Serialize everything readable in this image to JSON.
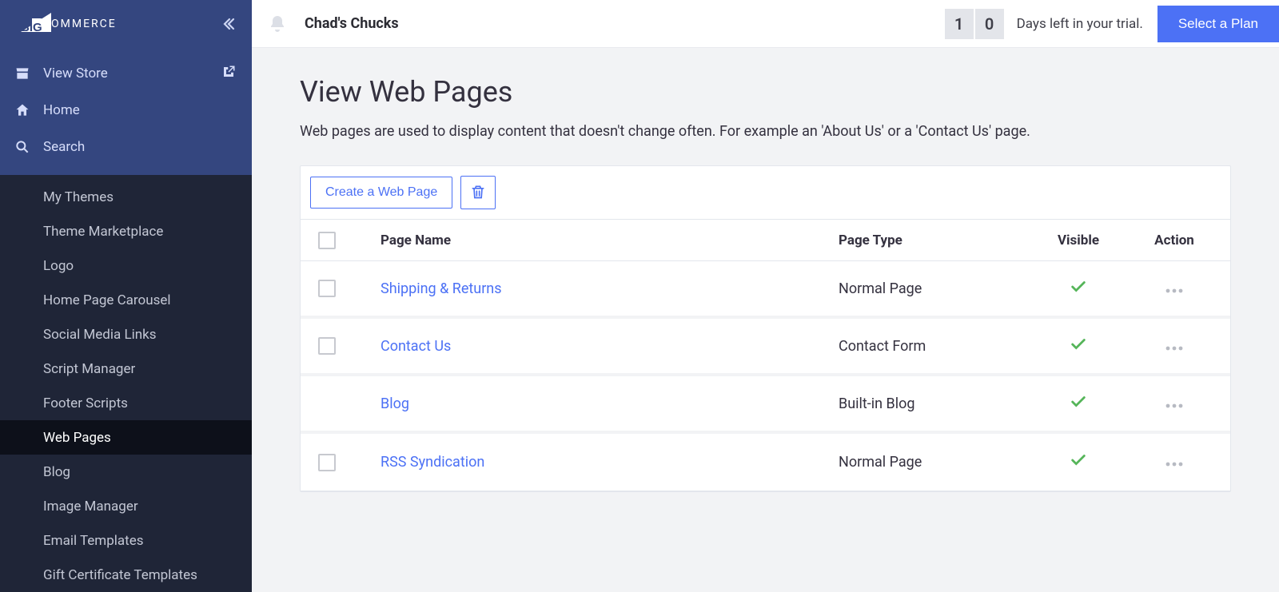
{
  "brand": {
    "name_suffix": "OMMERCE"
  },
  "sidebar": {
    "view_store_label": "View Store",
    "home_label": "Home",
    "search_label": "Search",
    "sub_items": [
      {
        "label": "My Themes"
      },
      {
        "label": "Theme Marketplace"
      },
      {
        "label": "Logo"
      },
      {
        "label": "Home Page Carousel"
      },
      {
        "label": "Social Media Links"
      },
      {
        "label": "Script Manager"
      },
      {
        "label": "Footer Scripts"
      },
      {
        "label": "Web Pages",
        "active": true
      },
      {
        "label": "Blog"
      },
      {
        "label": "Image Manager"
      },
      {
        "label": "Email Templates"
      },
      {
        "label": "Gift Certificate Templates"
      }
    ]
  },
  "topbar": {
    "store_name": "Chad's Chucks",
    "trial_digits": [
      "1",
      "0"
    ],
    "trial_text": "Days left in your trial.",
    "select_plan_label": "Select a Plan"
  },
  "page": {
    "title": "View Web Pages",
    "subtitle": "Web pages are used to display content that doesn't change often. For example an 'About Us' or a 'Contact Us' page."
  },
  "toolbar": {
    "create_label": "Create a Web Page"
  },
  "table": {
    "headers": {
      "name": "Page Name",
      "type": "Page Type",
      "visible": "Visible",
      "action": "Action"
    },
    "rows": [
      {
        "name": "Shipping & Returns",
        "type": "Normal Page",
        "visible": true,
        "has_checkbox": true
      },
      {
        "name": "Contact Us",
        "type": "Contact Form",
        "visible": true,
        "has_checkbox": true
      },
      {
        "name": "Blog",
        "type": "Built-in Blog",
        "visible": true,
        "has_checkbox": false
      },
      {
        "name": "RSS Syndication",
        "type": "Normal Page",
        "visible": true,
        "has_checkbox": true
      }
    ]
  }
}
